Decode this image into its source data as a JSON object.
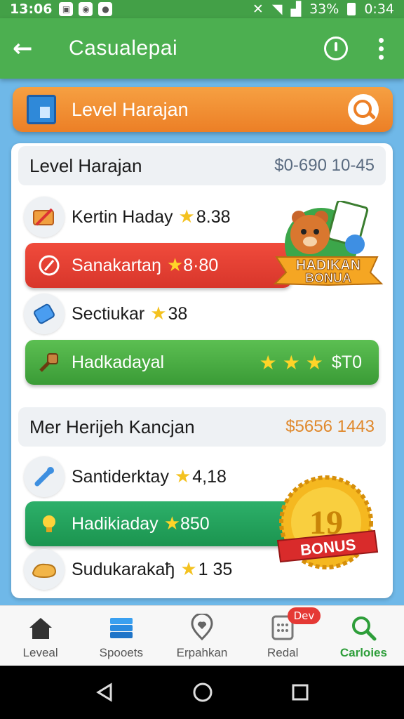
{
  "status": {
    "time": "13:06",
    "battery": "33%",
    "clock": "0:34"
  },
  "app_bar": {
    "title": "Casualepai"
  },
  "banner": {
    "label": "Level Harajan"
  },
  "section1": {
    "name": "Level Harajan",
    "amount": "$0-690 10-45",
    "rows": [
      {
        "label": "Kertin Haday",
        "value": "8.38"
      },
      {
        "label": "Sanakartaŋ",
        "value": "8·80"
      },
      {
        "label": "Sectiukar",
        "value": "38"
      },
      {
        "label": "Hadkadayal",
        "value": "$T0"
      }
    ],
    "badge": {
      "line1": "HADIKAN",
      "line2": "BONUA"
    }
  },
  "section2": {
    "name": "Mer Herijeh Kancjan",
    "amount": "$5656 1443",
    "rows": [
      {
        "label": "Santiderktay",
        "value": "4,18"
      },
      {
        "label": "Hadikiaday",
        "value": "850"
      },
      {
        "label": "Sudukarakaђ",
        "value": "1 35"
      }
    ],
    "badge": {
      "number": "19",
      "label": "BONUS"
    }
  },
  "bottom_nav": [
    {
      "label": "Leveal",
      "icon": "home-icon"
    },
    {
      "label": "Spooets",
      "icon": "stack-icon"
    },
    {
      "label": "Erpahkan",
      "icon": "heart-pin-icon"
    },
    {
      "label": "Redal",
      "icon": "calculator-icon",
      "badge": "Dev"
    },
    {
      "label": "Carloies",
      "icon": "search-icon",
      "active": true
    }
  ],
  "colors": {
    "primary": "#4caf50",
    "accent": "#ec7f26",
    "red": "#e53935"
  }
}
